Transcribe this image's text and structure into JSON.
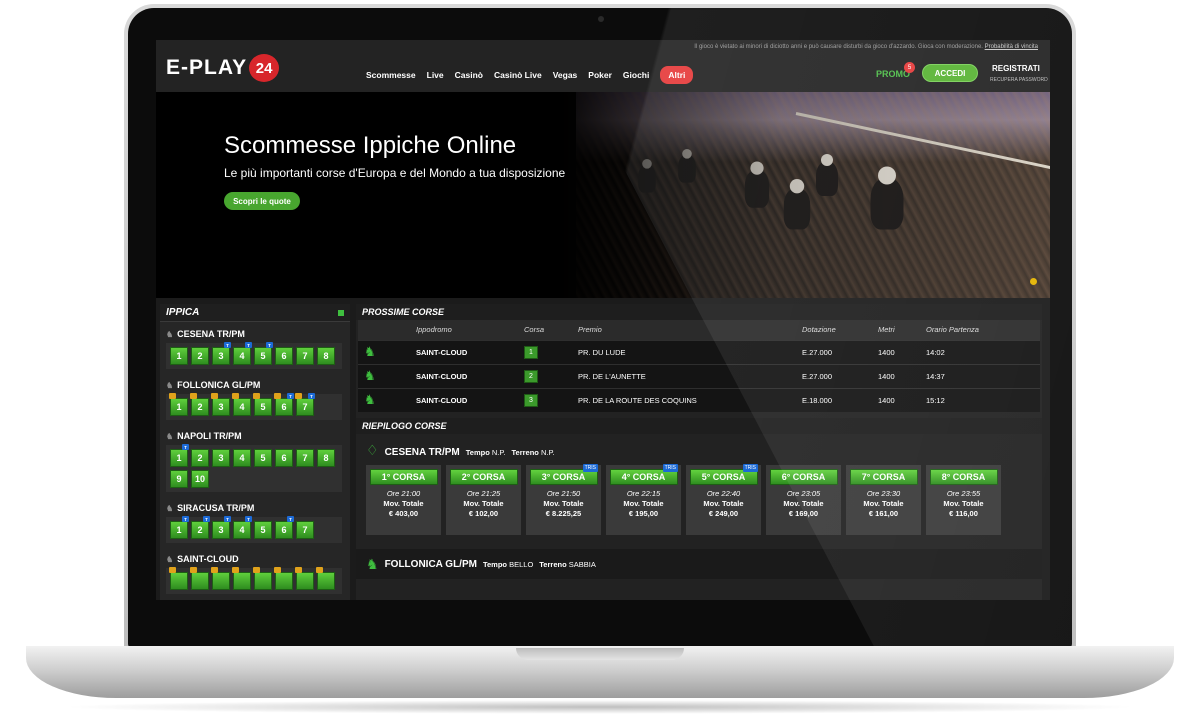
{
  "header": {
    "legal_text": "Il gioco è vietato ai minori di diciotto anni e può causare disturbi da gioco d'azzardo. Gioca con moderazione.",
    "legal_link": "Probabilità di vincita",
    "logo_text": "E-PLAY",
    "logo_badge": "24",
    "nav": [
      "Scommesse",
      "Live",
      "Casinò",
      "Casinò Live",
      "Vegas",
      "Poker",
      "Giochi"
    ],
    "nav_more": "Altri",
    "promo": "PROMO",
    "promo_count": "5",
    "login": "ACCEDI",
    "register": "REGISTRATI",
    "recover": "RECUPERA PASSWORD"
  },
  "hero": {
    "title": "Scommesse Ippiche Online",
    "subtitle": "Le più importanti corse d'Europa e del Mondo a tua disposizione",
    "cta": "Scopri le quote"
  },
  "sidebar": {
    "title": "IPPICA",
    "tracks": [
      {
        "name": "CESENA TR/PM",
        "races": [
          {
            "n": "1"
          },
          {
            "n": "2"
          },
          {
            "n": "3",
            "t": true
          },
          {
            "n": "4",
            "t": true
          },
          {
            "n": "5",
            "t": true
          },
          {
            "n": "6"
          },
          {
            "n": "7"
          },
          {
            "n": "8"
          }
        ]
      },
      {
        "name": "FOLLONICA GL/PM",
        "races": [
          {
            "n": "1",
            "q": true
          },
          {
            "n": "2",
            "q": true
          },
          {
            "n": "3",
            "q": true
          },
          {
            "n": "4",
            "q": true
          },
          {
            "n": "5",
            "q": true
          },
          {
            "n": "6",
            "q": true,
            "t": true
          },
          {
            "n": "7",
            "q": true,
            "t": true
          }
        ]
      },
      {
        "name": "NAPOLI TR/PM",
        "races": [
          {
            "n": "1",
            "t": true
          },
          {
            "n": "2"
          },
          {
            "n": "3"
          },
          {
            "n": "4"
          },
          {
            "n": "5"
          },
          {
            "n": "6"
          },
          {
            "n": "7"
          },
          {
            "n": "8"
          },
          {
            "n": "9"
          },
          {
            "n": "10"
          }
        ]
      },
      {
        "name": "SIRACUSA TR/PM",
        "races": [
          {
            "n": "1",
            "t": true
          },
          {
            "n": "2",
            "t": true
          },
          {
            "n": "3",
            "t": true
          },
          {
            "n": "4",
            "t": true
          },
          {
            "n": "5"
          },
          {
            "n": "6",
            "t": true
          },
          {
            "n": "7"
          }
        ]
      },
      {
        "name": "SAINT-CLOUD",
        "races": [
          {
            "n": "",
            "q": true
          },
          {
            "n": "",
            "q": true
          },
          {
            "n": "",
            "q": true
          },
          {
            "n": "",
            "q": true
          },
          {
            "n": "",
            "q": true
          },
          {
            "n": "",
            "q": true
          },
          {
            "n": "",
            "q": true
          },
          {
            "n": "",
            "q": true
          }
        ]
      }
    ]
  },
  "next": {
    "title": "PROSSIME CORSE",
    "columns": [
      "Ippodromo",
      "Corsa",
      "Premio",
      "Dotazione",
      "Metri",
      "Orario Partenza"
    ],
    "rows": [
      {
        "track": "SAINT-CLOUD",
        "race": "1",
        "prize": "PR. DU LUDE",
        "amount": "E.27.000",
        "meters": "1400",
        "time": "14:02"
      },
      {
        "track": "SAINT-CLOUD",
        "race": "2",
        "prize": "PR. DE L'AUNETTE",
        "amount": "E.27.000",
        "meters": "1400",
        "time": "14:37"
      },
      {
        "track": "SAINT-CLOUD",
        "race": "3",
        "prize": "PR. DE LA ROUTE DES COQUINS",
        "amount": "E.18.000",
        "meters": "1400",
        "time": "15:12"
      }
    ]
  },
  "summary": {
    "title": "RIEPILOGO CORSE",
    "track1": {
      "name": "CESENA TR/PM",
      "weather_label": "Tempo",
      "weather": "N.P.",
      "ground_label": "Terreno",
      "ground": "N.P."
    },
    "cards": [
      {
        "label": "1° CORSA",
        "time": "Ore 21:00",
        "mov": "Mov. Totale",
        "amount": "€ 403,00",
        "tris": false
      },
      {
        "label": "2° CORSA",
        "time": "Ore 21:25",
        "mov": "Mov. Totale",
        "amount": "€ 102,00",
        "tris": false
      },
      {
        "label": "3° CORSA",
        "time": "Ore 21:50",
        "mov": "Mov. Totale",
        "amount": "€ 8.225,25",
        "tris": true
      },
      {
        "label": "4° CORSA",
        "time": "Ore 22:15",
        "mov": "Mov. Totale",
        "amount": "€ 195,00",
        "tris": true
      },
      {
        "label": "5° CORSA",
        "time": "Ore 22:40",
        "mov": "Mov. Totale",
        "amount": "€ 249,00",
        "tris": true
      },
      {
        "label": "6° CORSA",
        "time": "Ore 23:05",
        "mov": "Mov. Totale",
        "amount": "€ 169,00",
        "tris": false
      },
      {
        "label": "7° CORSA",
        "time": "Ore 23:30",
        "mov": "Mov. Totale",
        "amount": "€ 161,00",
        "tris": false
      },
      {
        "label": "8° CORSA",
        "time": "Ore 23:55",
        "mov": "Mov. Totale",
        "amount": "€ 116,00",
        "tris": false
      }
    ],
    "tris_label": "TRIS",
    "track2": {
      "name": "FOLLONICA GL/PM",
      "weather_label": "Tempo",
      "weather": "BELLO",
      "ground_label": "Terreno",
      "ground": "SABBIA"
    }
  }
}
